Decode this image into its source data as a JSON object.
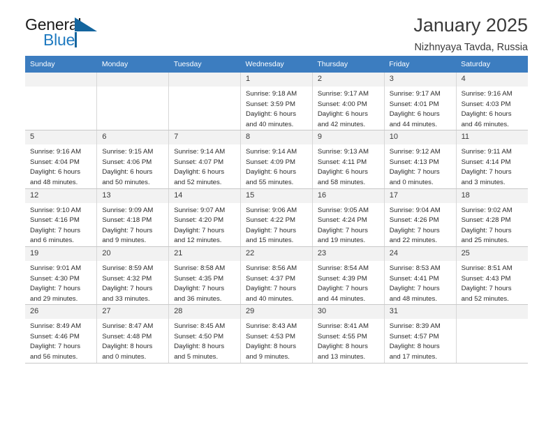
{
  "brand": {
    "name_top": "General",
    "name_bottom": "Blue",
    "accent_color": "#14659e",
    "blue_text_color": "#1f7ac0"
  },
  "header": {
    "title": "January 2025",
    "subtitle": "Nizhnyaya Tavda, Russia"
  },
  "calendar": {
    "header_bg": "#3c7dc0",
    "daynum_bg": "#f2f2f2",
    "weekdays": [
      "Sunday",
      "Monday",
      "Tuesday",
      "Wednesday",
      "Thursday",
      "Friday",
      "Saturday"
    ],
    "weeks": [
      [
        {
          "day": "",
          "empty": true
        },
        {
          "day": "",
          "empty": true
        },
        {
          "day": "",
          "empty": true
        },
        {
          "day": "1",
          "sunrise": "Sunrise: 9:18 AM",
          "sunset": "Sunset: 3:59 PM",
          "daylight1": "Daylight: 6 hours",
          "daylight2": "and 40 minutes."
        },
        {
          "day": "2",
          "sunrise": "Sunrise: 9:17 AM",
          "sunset": "Sunset: 4:00 PM",
          "daylight1": "Daylight: 6 hours",
          "daylight2": "and 42 minutes."
        },
        {
          "day": "3",
          "sunrise": "Sunrise: 9:17 AM",
          "sunset": "Sunset: 4:01 PM",
          "daylight1": "Daylight: 6 hours",
          "daylight2": "and 44 minutes."
        },
        {
          "day": "4",
          "sunrise": "Sunrise: 9:16 AM",
          "sunset": "Sunset: 4:03 PM",
          "daylight1": "Daylight: 6 hours",
          "daylight2": "and 46 minutes."
        }
      ],
      [
        {
          "day": "5",
          "sunrise": "Sunrise: 9:16 AM",
          "sunset": "Sunset: 4:04 PM",
          "daylight1": "Daylight: 6 hours",
          "daylight2": "and 48 minutes."
        },
        {
          "day": "6",
          "sunrise": "Sunrise: 9:15 AM",
          "sunset": "Sunset: 4:06 PM",
          "daylight1": "Daylight: 6 hours",
          "daylight2": "and 50 minutes."
        },
        {
          "day": "7",
          "sunrise": "Sunrise: 9:14 AM",
          "sunset": "Sunset: 4:07 PM",
          "daylight1": "Daylight: 6 hours",
          "daylight2": "and 52 minutes."
        },
        {
          "day": "8",
          "sunrise": "Sunrise: 9:14 AM",
          "sunset": "Sunset: 4:09 PM",
          "daylight1": "Daylight: 6 hours",
          "daylight2": "and 55 minutes."
        },
        {
          "day": "9",
          "sunrise": "Sunrise: 9:13 AM",
          "sunset": "Sunset: 4:11 PM",
          "daylight1": "Daylight: 6 hours",
          "daylight2": "and 58 minutes."
        },
        {
          "day": "10",
          "sunrise": "Sunrise: 9:12 AM",
          "sunset": "Sunset: 4:13 PM",
          "daylight1": "Daylight: 7 hours",
          "daylight2": "and 0 minutes."
        },
        {
          "day": "11",
          "sunrise": "Sunrise: 9:11 AM",
          "sunset": "Sunset: 4:14 PM",
          "daylight1": "Daylight: 7 hours",
          "daylight2": "and 3 minutes."
        }
      ],
      [
        {
          "day": "12",
          "sunrise": "Sunrise: 9:10 AM",
          "sunset": "Sunset: 4:16 PM",
          "daylight1": "Daylight: 7 hours",
          "daylight2": "and 6 minutes."
        },
        {
          "day": "13",
          "sunrise": "Sunrise: 9:09 AM",
          "sunset": "Sunset: 4:18 PM",
          "daylight1": "Daylight: 7 hours",
          "daylight2": "and 9 minutes."
        },
        {
          "day": "14",
          "sunrise": "Sunrise: 9:07 AM",
          "sunset": "Sunset: 4:20 PM",
          "daylight1": "Daylight: 7 hours",
          "daylight2": "and 12 minutes."
        },
        {
          "day": "15",
          "sunrise": "Sunrise: 9:06 AM",
          "sunset": "Sunset: 4:22 PM",
          "daylight1": "Daylight: 7 hours",
          "daylight2": "and 15 minutes."
        },
        {
          "day": "16",
          "sunrise": "Sunrise: 9:05 AM",
          "sunset": "Sunset: 4:24 PM",
          "daylight1": "Daylight: 7 hours",
          "daylight2": "and 19 minutes."
        },
        {
          "day": "17",
          "sunrise": "Sunrise: 9:04 AM",
          "sunset": "Sunset: 4:26 PM",
          "daylight1": "Daylight: 7 hours",
          "daylight2": "and 22 minutes."
        },
        {
          "day": "18",
          "sunrise": "Sunrise: 9:02 AM",
          "sunset": "Sunset: 4:28 PM",
          "daylight1": "Daylight: 7 hours",
          "daylight2": "and 25 minutes."
        }
      ],
      [
        {
          "day": "19",
          "sunrise": "Sunrise: 9:01 AM",
          "sunset": "Sunset: 4:30 PM",
          "daylight1": "Daylight: 7 hours",
          "daylight2": "and 29 minutes."
        },
        {
          "day": "20",
          "sunrise": "Sunrise: 8:59 AM",
          "sunset": "Sunset: 4:32 PM",
          "daylight1": "Daylight: 7 hours",
          "daylight2": "and 33 minutes."
        },
        {
          "day": "21",
          "sunrise": "Sunrise: 8:58 AM",
          "sunset": "Sunset: 4:35 PM",
          "daylight1": "Daylight: 7 hours",
          "daylight2": "and 36 minutes."
        },
        {
          "day": "22",
          "sunrise": "Sunrise: 8:56 AM",
          "sunset": "Sunset: 4:37 PM",
          "daylight1": "Daylight: 7 hours",
          "daylight2": "and 40 minutes."
        },
        {
          "day": "23",
          "sunrise": "Sunrise: 8:54 AM",
          "sunset": "Sunset: 4:39 PM",
          "daylight1": "Daylight: 7 hours",
          "daylight2": "and 44 minutes."
        },
        {
          "day": "24",
          "sunrise": "Sunrise: 8:53 AM",
          "sunset": "Sunset: 4:41 PM",
          "daylight1": "Daylight: 7 hours",
          "daylight2": "and 48 minutes."
        },
        {
          "day": "25",
          "sunrise": "Sunrise: 8:51 AM",
          "sunset": "Sunset: 4:43 PM",
          "daylight1": "Daylight: 7 hours",
          "daylight2": "and 52 minutes."
        }
      ],
      [
        {
          "day": "26",
          "sunrise": "Sunrise: 8:49 AM",
          "sunset": "Sunset: 4:46 PM",
          "daylight1": "Daylight: 7 hours",
          "daylight2": "and 56 minutes."
        },
        {
          "day": "27",
          "sunrise": "Sunrise: 8:47 AM",
          "sunset": "Sunset: 4:48 PM",
          "daylight1": "Daylight: 8 hours",
          "daylight2": "and 0 minutes."
        },
        {
          "day": "28",
          "sunrise": "Sunrise: 8:45 AM",
          "sunset": "Sunset: 4:50 PM",
          "daylight1": "Daylight: 8 hours",
          "daylight2": "and 5 minutes."
        },
        {
          "day": "29",
          "sunrise": "Sunrise: 8:43 AM",
          "sunset": "Sunset: 4:53 PM",
          "daylight1": "Daylight: 8 hours",
          "daylight2": "and 9 minutes."
        },
        {
          "day": "30",
          "sunrise": "Sunrise: 8:41 AM",
          "sunset": "Sunset: 4:55 PM",
          "daylight1": "Daylight: 8 hours",
          "daylight2": "and 13 minutes."
        },
        {
          "day": "31",
          "sunrise": "Sunrise: 8:39 AM",
          "sunset": "Sunset: 4:57 PM",
          "daylight1": "Daylight: 8 hours",
          "daylight2": "and 17 minutes."
        },
        {
          "day": "",
          "empty": true
        }
      ]
    ]
  }
}
